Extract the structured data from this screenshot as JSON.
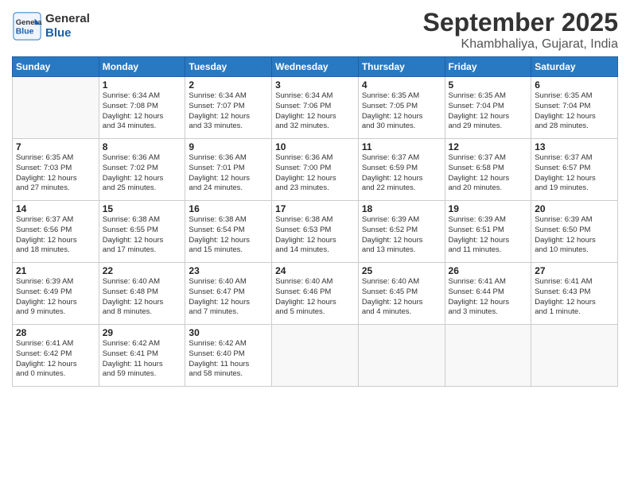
{
  "header": {
    "logo_general": "General",
    "logo_blue": "Blue",
    "title": "September 2025",
    "location": "Khambhaliya, Gujarat, India"
  },
  "days_of_week": [
    "Sunday",
    "Monday",
    "Tuesday",
    "Wednesday",
    "Thursday",
    "Friday",
    "Saturday"
  ],
  "weeks": [
    [
      {
        "day": "",
        "info": ""
      },
      {
        "day": "1",
        "info": "Sunrise: 6:34 AM\nSunset: 7:08 PM\nDaylight: 12 hours\nand 34 minutes."
      },
      {
        "day": "2",
        "info": "Sunrise: 6:34 AM\nSunset: 7:07 PM\nDaylight: 12 hours\nand 33 minutes."
      },
      {
        "day": "3",
        "info": "Sunrise: 6:34 AM\nSunset: 7:06 PM\nDaylight: 12 hours\nand 32 minutes."
      },
      {
        "day": "4",
        "info": "Sunrise: 6:35 AM\nSunset: 7:05 PM\nDaylight: 12 hours\nand 30 minutes."
      },
      {
        "day": "5",
        "info": "Sunrise: 6:35 AM\nSunset: 7:04 PM\nDaylight: 12 hours\nand 29 minutes."
      },
      {
        "day": "6",
        "info": "Sunrise: 6:35 AM\nSunset: 7:04 PM\nDaylight: 12 hours\nand 28 minutes."
      }
    ],
    [
      {
        "day": "7",
        "info": "Sunrise: 6:35 AM\nSunset: 7:03 PM\nDaylight: 12 hours\nand 27 minutes."
      },
      {
        "day": "8",
        "info": "Sunrise: 6:36 AM\nSunset: 7:02 PM\nDaylight: 12 hours\nand 25 minutes."
      },
      {
        "day": "9",
        "info": "Sunrise: 6:36 AM\nSunset: 7:01 PM\nDaylight: 12 hours\nand 24 minutes."
      },
      {
        "day": "10",
        "info": "Sunrise: 6:36 AM\nSunset: 7:00 PM\nDaylight: 12 hours\nand 23 minutes."
      },
      {
        "day": "11",
        "info": "Sunrise: 6:37 AM\nSunset: 6:59 PM\nDaylight: 12 hours\nand 22 minutes."
      },
      {
        "day": "12",
        "info": "Sunrise: 6:37 AM\nSunset: 6:58 PM\nDaylight: 12 hours\nand 20 minutes."
      },
      {
        "day": "13",
        "info": "Sunrise: 6:37 AM\nSunset: 6:57 PM\nDaylight: 12 hours\nand 19 minutes."
      }
    ],
    [
      {
        "day": "14",
        "info": "Sunrise: 6:37 AM\nSunset: 6:56 PM\nDaylight: 12 hours\nand 18 minutes."
      },
      {
        "day": "15",
        "info": "Sunrise: 6:38 AM\nSunset: 6:55 PM\nDaylight: 12 hours\nand 17 minutes."
      },
      {
        "day": "16",
        "info": "Sunrise: 6:38 AM\nSunset: 6:54 PM\nDaylight: 12 hours\nand 15 minutes."
      },
      {
        "day": "17",
        "info": "Sunrise: 6:38 AM\nSunset: 6:53 PM\nDaylight: 12 hours\nand 14 minutes."
      },
      {
        "day": "18",
        "info": "Sunrise: 6:39 AM\nSunset: 6:52 PM\nDaylight: 12 hours\nand 13 minutes."
      },
      {
        "day": "19",
        "info": "Sunrise: 6:39 AM\nSunset: 6:51 PM\nDaylight: 12 hours\nand 11 minutes."
      },
      {
        "day": "20",
        "info": "Sunrise: 6:39 AM\nSunset: 6:50 PM\nDaylight: 12 hours\nand 10 minutes."
      }
    ],
    [
      {
        "day": "21",
        "info": "Sunrise: 6:39 AM\nSunset: 6:49 PM\nDaylight: 12 hours\nand 9 minutes."
      },
      {
        "day": "22",
        "info": "Sunrise: 6:40 AM\nSunset: 6:48 PM\nDaylight: 12 hours\nand 8 minutes."
      },
      {
        "day": "23",
        "info": "Sunrise: 6:40 AM\nSunset: 6:47 PM\nDaylight: 12 hours\nand 7 minutes."
      },
      {
        "day": "24",
        "info": "Sunrise: 6:40 AM\nSunset: 6:46 PM\nDaylight: 12 hours\nand 5 minutes."
      },
      {
        "day": "25",
        "info": "Sunrise: 6:40 AM\nSunset: 6:45 PM\nDaylight: 12 hours\nand 4 minutes."
      },
      {
        "day": "26",
        "info": "Sunrise: 6:41 AM\nSunset: 6:44 PM\nDaylight: 12 hours\nand 3 minutes."
      },
      {
        "day": "27",
        "info": "Sunrise: 6:41 AM\nSunset: 6:43 PM\nDaylight: 12 hours\nand 1 minute."
      }
    ],
    [
      {
        "day": "28",
        "info": "Sunrise: 6:41 AM\nSunset: 6:42 PM\nDaylight: 12 hours\nand 0 minutes."
      },
      {
        "day": "29",
        "info": "Sunrise: 6:42 AM\nSunset: 6:41 PM\nDaylight: 11 hours\nand 59 minutes."
      },
      {
        "day": "30",
        "info": "Sunrise: 6:42 AM\nSunset: 6:40 PM\nDaylight: 11 hours\nand 58 minutes."
      },
      {
        "day": "",
        "info": ""
      },
      {
        "day": "",
        "info": ""
      },
      {
        "day": "",
        "info": ""
      },
      {
        "day": "",
        "info": ""
      }
    ]
  ]
}
